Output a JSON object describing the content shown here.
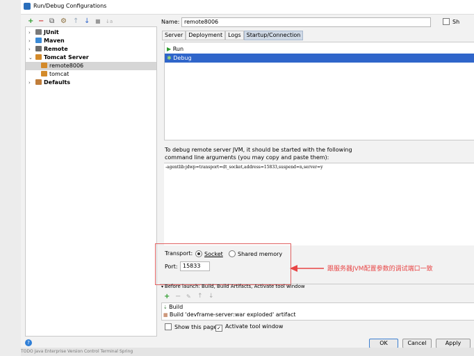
{
  "window": {
    "title": "Run/Debug Configurations"
  },
  "toolbar": {
    "add": "+",
    "remove": "−",
    "copy": "⧉",
    "settings": "⚙",
    "up": "↑",
    "down": "↓",
    "folder": "■",
    "sort": "↓a"
  },
  "tree": {
    "items": [
      {
        "label": "JUnit",
        "chevron": "›",
        "bold": true,
        "icon_color": "#7a7a7a"
      },
      {
        "label": "Maven",
        "chevron": "›",
        "bold": true,
        "icon_color": "#3a8ad6"
      },
      {
        "label": "Remote",
        "chevron": "›",
        "bold": true,
        "icon_color": "#6b6b6b"
      },
      {
        "label": "Tomcat Server",
        "chevron": "⌄",
        "bold": true,
        "icon_color": "#d38a2a"
      },
      {
        "label": "remote8006",
        "chevron": "",
        "bold": false,
        "icon_color": "#d38a2a",
        "selected": true
      },
      {
        "label": "tomcat",
        "chevron": "",
        "bold": false,
        "icon_color": "#d38a2a"
      },
      {
        "label": "Defaults",
        "chevron": "›",
        "bold": true,
        "icon_color": "#c07d3a"
      }
    ]
  },
  "name": {
    "label": "Name:",
    "value": "remote8006",
    "share_label": "Sh"
  },
  "tabs": [
    "Server",
    "Deployment",
    "Logs",
    "Startup/Connection"
  ],
  "modes": [
    {
      "label": "Run",
      "icon": "▶",
      "selected": false
    },
    {
      "label": "Debug",
      "icon": "✱",
      "selected": true
    }
  ],
  "description": {
    "line1": "To debug remote server JVM, it should be started with the following",
    "line2": "command line arguments (you may copy and paste them):"
  },
  "args": "-agentlib:jdwp=transport=dt_socket,address=15833,suspend=n,server=y",
  "transport": {
    "label": "Transport:",
    "options": [
      {
        "label": "Socket",
        "checked": true
      },
      {
        "label": "Shared memory",
        "checked": false
      }
    ]
  },
  "port": {
    "label": "Port:",
    "value": "15833"
  },
  "annotation": "跟服务器JVM配置参数的调试端口一致",
  "before_launch": {
    "header": "Before launch: Build, Build Artifacts, Activate tool window",
    "items": [
      "Build",
      "Build 'devframe-server:war exploded' artifact"
    ]
  },
  "options": {
    "show_page": "Show this page",
    "activate_tool": "Activate tool window"
  },
  "buttons": {
    "ok": "OK",
    "cancel": "Cancel",
    "apply": "Apply"
  },
  "help": "?",
  "statusbar": "TODO   Java Enterprise   Version Control   Terminal   Spring",
  "colors": {
    "accent": "#2f65ca",
    "annotation": "#e84545",
    "annotation_box": "#e06060"
  }
}
